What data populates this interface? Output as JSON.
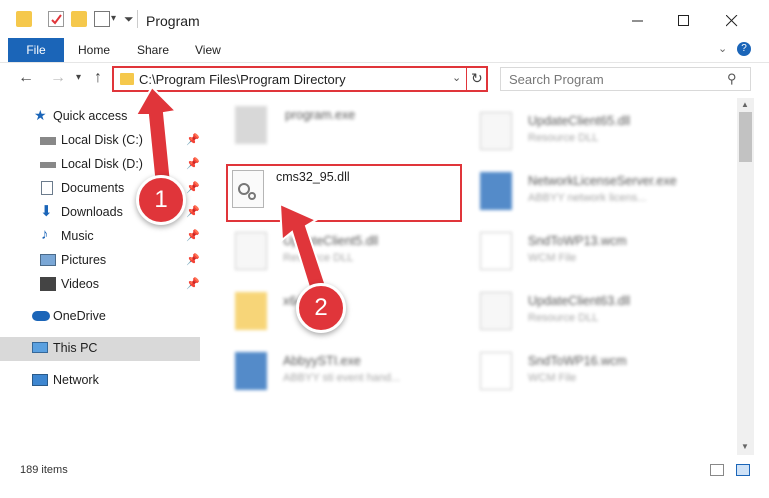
{
  "window": {
    "title": "Program"
  },
  "ribbon": {
    "tabs": [
      "File",
      "Home",
      "Share",
      "View"
    ]
  },
  "address": {
    "path": "C:\\Program Files\\Program Directory"
  },
  "search": {
    "placeholder": "Search Program"
  },
  "sidebar": {
    "items": [
      {
        "label": "Quick access"
      },
      {
        "label": "Local Disk (C:)"
      },
      {
        "label": "Local Disk (D:)"
      },
      {
        "label": "Documents"
      },
      {
        "label": "Downloads"
      },
      {
        "label": "Music"
      },
      {
        "label": "Pictures"
      },
      {
        "label": "Videos"
      },
      {
        "label": "OneDrive"
      },
      {
        "label": "This PC"
      },
      {
        "label": "Network"
      }
    ]
  },
  "files": {
    "program_exe": {
      "name": "program.exe",
      "desc": ""
    },
    "cms32": {
      "name": "cms32_95.dll"
    },
    "updateclient5": {
      "name": "UpdateClient5.dll",
      "desc": "Resource DLL"
    },
    "x64": {
      "name": "x64"
    },
    "abbyysti": {
      "name": "AbbyySTI.exe",
      "desc": "ABBYY sti event hand..."
    },
    "updateclient65": {
      "name": "UpdateClient65.dll",
      "desc": "Resource DLL"
    },
    "networklicense": {
      "name": "NetworkLicenseServer.exe",
      "desc": "ABBYY network licens..."
    },
    "sndtowp13": {
      "name": "SndToWP13.wcm",
      "desc": "WCM File"
    },
    "updateclient63": {
      "name": "UpdateClient63.dll",
      "desc": "Resource DLL"
    },
    "sndtowp16": {
      "name": "SndToWP16.wcm",
      "desc": "WCM File"
    }
  },
  "status": {
    "count": "189 items"
  },
  "annotations": {
    "badge1": "1",
    "badge2": "2"
  },
  "colors": {
    "accent": "#1b65b8",
    "highlight": "#e0353a"
  }
}
